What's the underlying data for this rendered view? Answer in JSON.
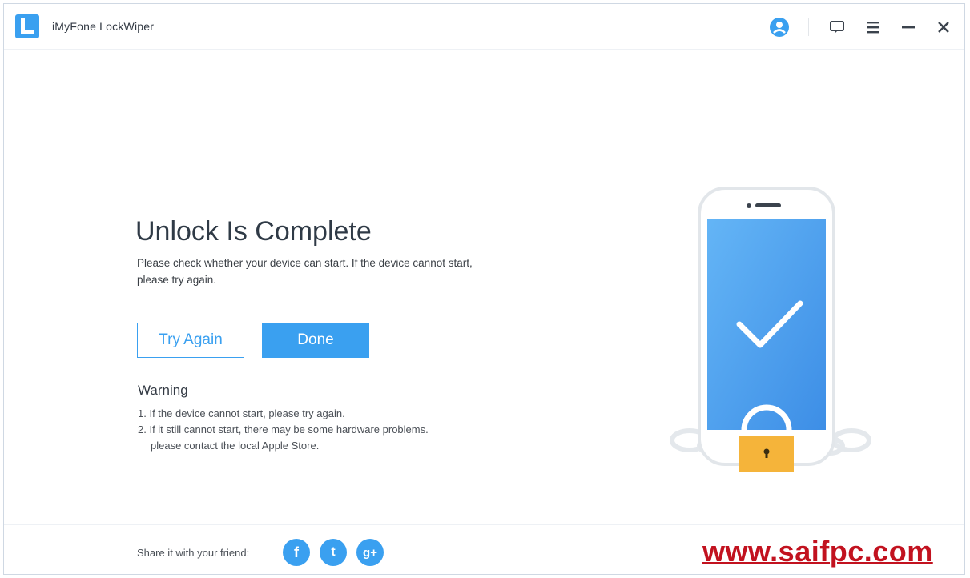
{
  "window": {
    "title": "iMyFone LockWiper"
  },
  "main": {
    "headline": "Unlock Is Complete",
    "description": "Please check whether your device can start. If the device cannot start, please try again.",
    "try_again_label": "Try Again",
    "done_label": "Done",
    "warning_title": "Warning",
    "warnings": [
      "1. If the device cannot start, please try again.",
      "2. If it still cannot start, there may be some hardware problems.",
      "please contact the local Apple Store."
    ]
  },
  "footer": {
    "share_label": "Share it with your friend:",
    "social": [
      {
        "name": "facebook-icon",
        "glyph": "f"
      },
      {
        "name": "twitter-icon",
        "glyph": "t"
      },
      {
        "name": "google-plus-icon",
        "glyph": "g+"
      }
    ],
    "watermark": "www.saifpc.com"
  },
  "colors": {
    "accent": "#3aa0f0",
    "lock": "#f5b43a",
    "watermark": "#c2121f"
  }
}
